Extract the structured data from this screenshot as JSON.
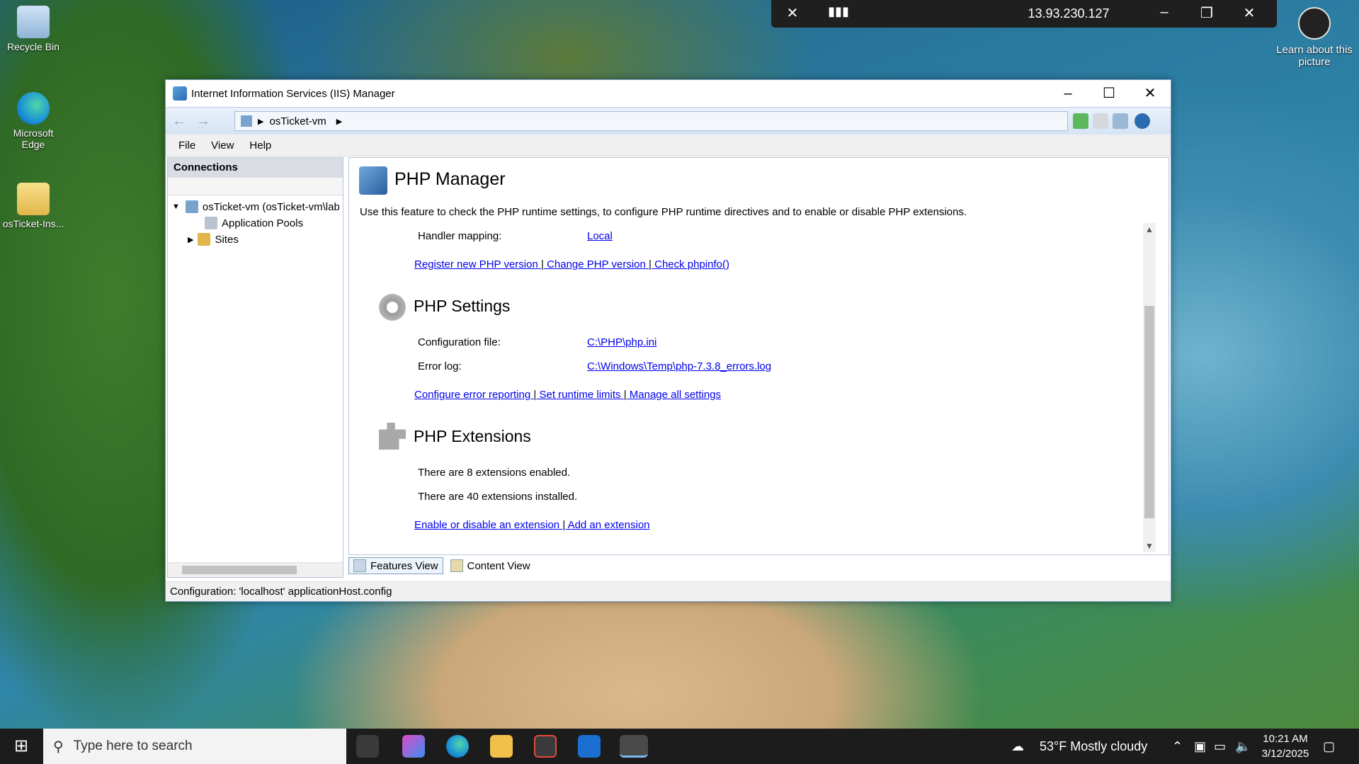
{
  "desktop": {
    "icons": [
      {
        "label": "Recycle Bin"
      },
      {
        "label": "Microsoft Edge"
      },
      {
        "label": "osTicket-Ins..."
      }
    ],
    "learn_label": "Learn about this picture"
  },
  "rdp": {
    "ip": "13.93.230.127"
  },
  "window": {
    "title": "Internet Information Services (IIS) Manager",
    "address_segment": "osTicket-vm",
    "menu": [
      "File",
      "View",
      "Help"
    ],
    "connections": {
      "header": "Connections",
      "tree": [
        {
          "label": "osTicket-vm (osTicket-vm\\lab"
        },
        {
          "label": "Application Pools"
        },
        {
          "label": "Sites"
        }
      ]
    },
    "content": {
      "title": "PHP Manager",
      "description": "Use this feature to check the PHP runtime settings, to configure PHP runtime directives and to enable or disable PHP extensions.",
      "handler_mapping_label": "Handler mapping:",
      "handler_mapping_value": "Local",
      "setup_links": [
        "Register new PHP version",
        "Change PHP version",
        "Check phpinfo()"
      ],
      "settings": {
        "title": "PHP Settings",
        "config_label": "Configuration file:",
        "config_value": "C:\\PHP\\php.ini",
        "errorlog_label": "Error log:",
        "errorlog_value": "C:\\Windows\\Temp\\php-7.3.8_errors.log",
        "links": [
          "Configure error reporting",
          "Set runtime limits",
          "Manage all settings"
        ]
      },
      "extensions": {
        "title": "PHP Extensions",
        "enabled_text": "There are 8 extensions enabled.",
        "installed_text": "There are 40 extensions installed.",
        "links": [
          "Enable or disable an extension",
          "Add an extension"
        ]
      },
      "separator": "|"
    },
    "view_tabs": [
      "Features View",
      "Content View"
    ],
    "status": "Configuration: 'localhost' applicationHost.config"
  },
  "taskbar": {
    "search_placeholder": "Type here to search",
    "weather": "53°F  Mostly cloudy",
    "time": "10:21 AM",
    "date": "3/12/2025"
  }
}
